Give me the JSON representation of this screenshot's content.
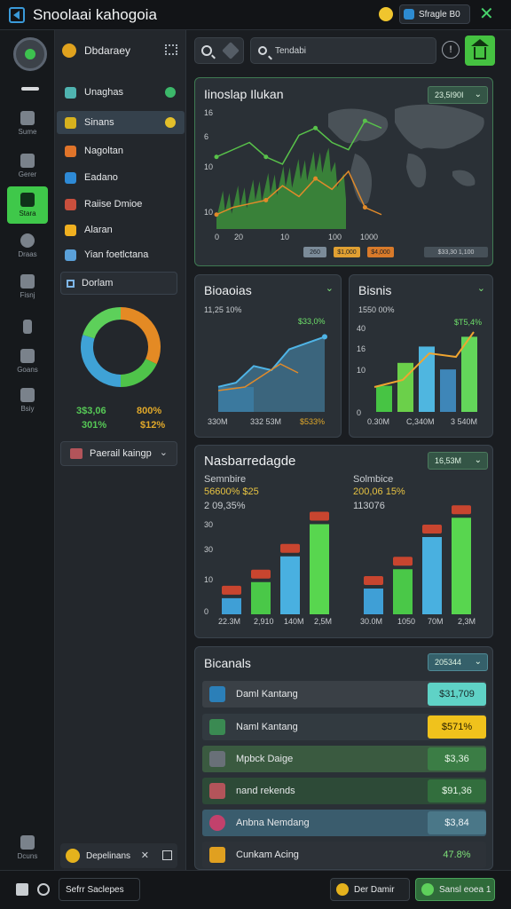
{
  "app": {
    "title": "Snoolaai kahogoia",
    "status_chip": "Sfragle B0"
  },
  "rail": {
    "items": [
      {
        "label": "Sume"
      },
      {
        "label": "Gerer"
      },
      {
        "label": "Stara"
      },
      {
        "label": "Draas"
      },
      {
        "label": "Fisnj"
      },
      {
        "label": ""
      },
      {
        "label": "Goans"
      },
      {
        "label": "Bsiy"
      },
      {
        "label": "Dcuns"
      }
    ]
  },
  "panel": {
    "title": "Dbdaraey",
    "items": [
      {
        "label": "Unaghas",
        "color": "#4fb3b0"
      },
      {
        "label": "Sinans",
        "color": "#d6b11e"
      },
      {
        "label": "Nagoltan",
        "color": "#e0742a"
      },
      {
        "label": "Eadano",
        "color": "#2e8ad6"
      },
      {
        "label": "Raiise Dmioe",
        "color": "#c94f3d"
      },
      {
        "label": "Alaran",
        "color": "#f0b020"
      },
      {
        "label": "Yian foetlctana",
        "color": "#5aa0d8"
      }
    ],
    "tab_label": "Dorlam",
    "donut": {
      "segments": [
        {
          "value": 32,
          "color": "#e48a24"
        },
        {
          "value": 18,
          "color": "#4fc44a"
        },
        {
          "value": 30,
          "color": "#3fa2d6"
        },
        {
          "value": 20,
          "color": "#5dd05a"
        }
      ]
    },
    "stats": [
      {
        "value": "3$3,06",
        "color": "#56c956"
      },
      {
        "value": "800%",
        "color": "#e0a82a"
      },
      {
        "value": "301%",
        "color": "#56c956"
      },
      {
        "value": "$12%",
        "color": "#e0a82a"
      }
    ],
    "dropdown": "Paerail kaingp",
    "footer": "Depelinans"
  },
  "toolbar": {
    "search_placeholder": "Tendabi",
    "info": "!"
  },
  "card_main": {
    "title": "Iinoslap Ilukan",
    "pill": "23,5I90I",
    "y_ticks": [
      "16",
      "6",
      "10",
      "10",
      "0"
    ],
    "x_ticks": [
      "0",
      "20",
      "10",
      "100",
      "1000"
    ],
    "legend": [
      {
        "label": "260",
        "color": "#8a9aa8"
      },
      {
        "label": "$1,000",
        "color": "#e0a032"
      },
      {
        "label": "$4,000",
        "color": "#d87a2a"
      },
      {
        "label": "$33,30 1,100",
        "color": "#465058"
      }
    ]
  },
  "card_b1": {
    "title": "Bioaoias",
    "subtitle": "11,25 10%",
    "peak": "$33,0%",
    "x_labels": [
      "330M",
      "332 53M",
      "$533%"
    ]
  },
  "card_b2": {
    "title": "Bisnis",
    "subtitle": "1550 00%",
    "peak": "$T5,4%",
    "y_ticks": [
      "40",
      "16",
      "10",
      "0"
    ],
    "x_labels": [
      "0.30M",
      "C,340M",
      "3 540M"
    ]
  },
  "card_bars": {
    "title": "Nasbarredagde",
    "pill": "16,53M",
    "left": {
      "label": "Semnbire",
      "value": "56600% $25",
      "sub": "2 09,35%",
      "y_ticks": [
        "30",
        "30",
        "10",
        "0"
      ],
      "x_labels": [
        "22.3M",
        "2,910",
        "140M",
        "2,5M"
      ]
    },
    "right": {
      "label": "Solmbice",
      "value": "200,06 15%",
      "sub": "113076",
      "x_labels": [
        "30.0M",
        "1050",
        "70M",
        "2,3M"
      ]
    }
  },
  "chart_data": [
    {
      "type": "line",
      "title": "Iinoslap Ilukan",
      "x": [
        0,
        1,
        2,
        3,
        4,
        5,
        6,
        7,
        8,
        9,
        10
      ],
      "series": [
        {
          "values": [
            2,
            3,
            3.5,
            4,
            6,
            4.5,
            7,
            5.5,
            8,
            3,
            2
          ]
        },
        {
          "values": [
            10,
            11,
            12,
            10,
            9,
            13,
            14,
            12,
            11,
            15,
            14
          ]
        }
      ]
    },
    {
      "type": "area",
      "title": "Bioaoias",
      "categories": [
        "330M",
        "332 53M",
        "$533%"
      ],
      "values": [
        12,
        14,
        22,
        20,
        30,
        33,
        36
      ]
    },
    {
      "type": "bar",
      "title": "Bisnis",
      "categories": [
        "0.30M",
        "C,340M",
        "3 540M"
      ],
      "values": [
        8,
        15,
        20,
        13,
        23
      ]
    },
    {
      "type": "bar",
      "title": "Nasbarredagde",
      "categories": [
        "22.3M",
        "2,910",
        "140M",
        "2,5M"
      ],
      "series": [
        {
          "values": [
            5,
            10,
            18,
            28
          ]
        },
        {
          "values": [
            8,
            14,
            24,
            30
          ]
        }
      ]
    }
  ],
  "card_list": {
    "title": "Bicanals",
    "pill": "205344",
    "rows": [
      {
        "label": "Daml Kantang",
        "value": "$31,709",
        "icon_color": "#2b7fb8",
        "bg": "#3a4046",
        "val_bg": "#5fd2c6"
      },
      {
        "label": "Naml Kantang",
        "value": "$571%",
        "icon_color": "#3a8a52",
        "bg": "#323a40",
        "val_bg": "#f0c21c"
      },
      {
        "label": "Mpbck Daige",
        "value": "$3,36",
        "icon_color": "#697078",
        "bg": "#3a5a40",
        "val_bg": "#3b7d45"
      },
      {
        "label": "nand rekends",
        "value": "$91,36",
        "icon_color": "#b3545a",
        "bg": "#2d4a37",
        "val_bg": "#326e3d"
      },
      {
        "label": "Anbna Nemdang",
        "value": "$3,84",
        "icon_color": "#c2416c",
        "bg": "#3a5c6d",
        "val_bg": "#4a7788"
      },
      {
        "label": "Cunkam Acing",
        "value": "47.8%",
        "icon_color": "#e0a020",
        "bg": "#2d3238",
        "val_bg": "#2d3238"
      }
    ]
  },
  "bottom": {
    "settings_label": "Sefrr Saclepes",
    "btn1": "Der Damir",
    "btn2": "Sansl eoea 1"
  }
}
